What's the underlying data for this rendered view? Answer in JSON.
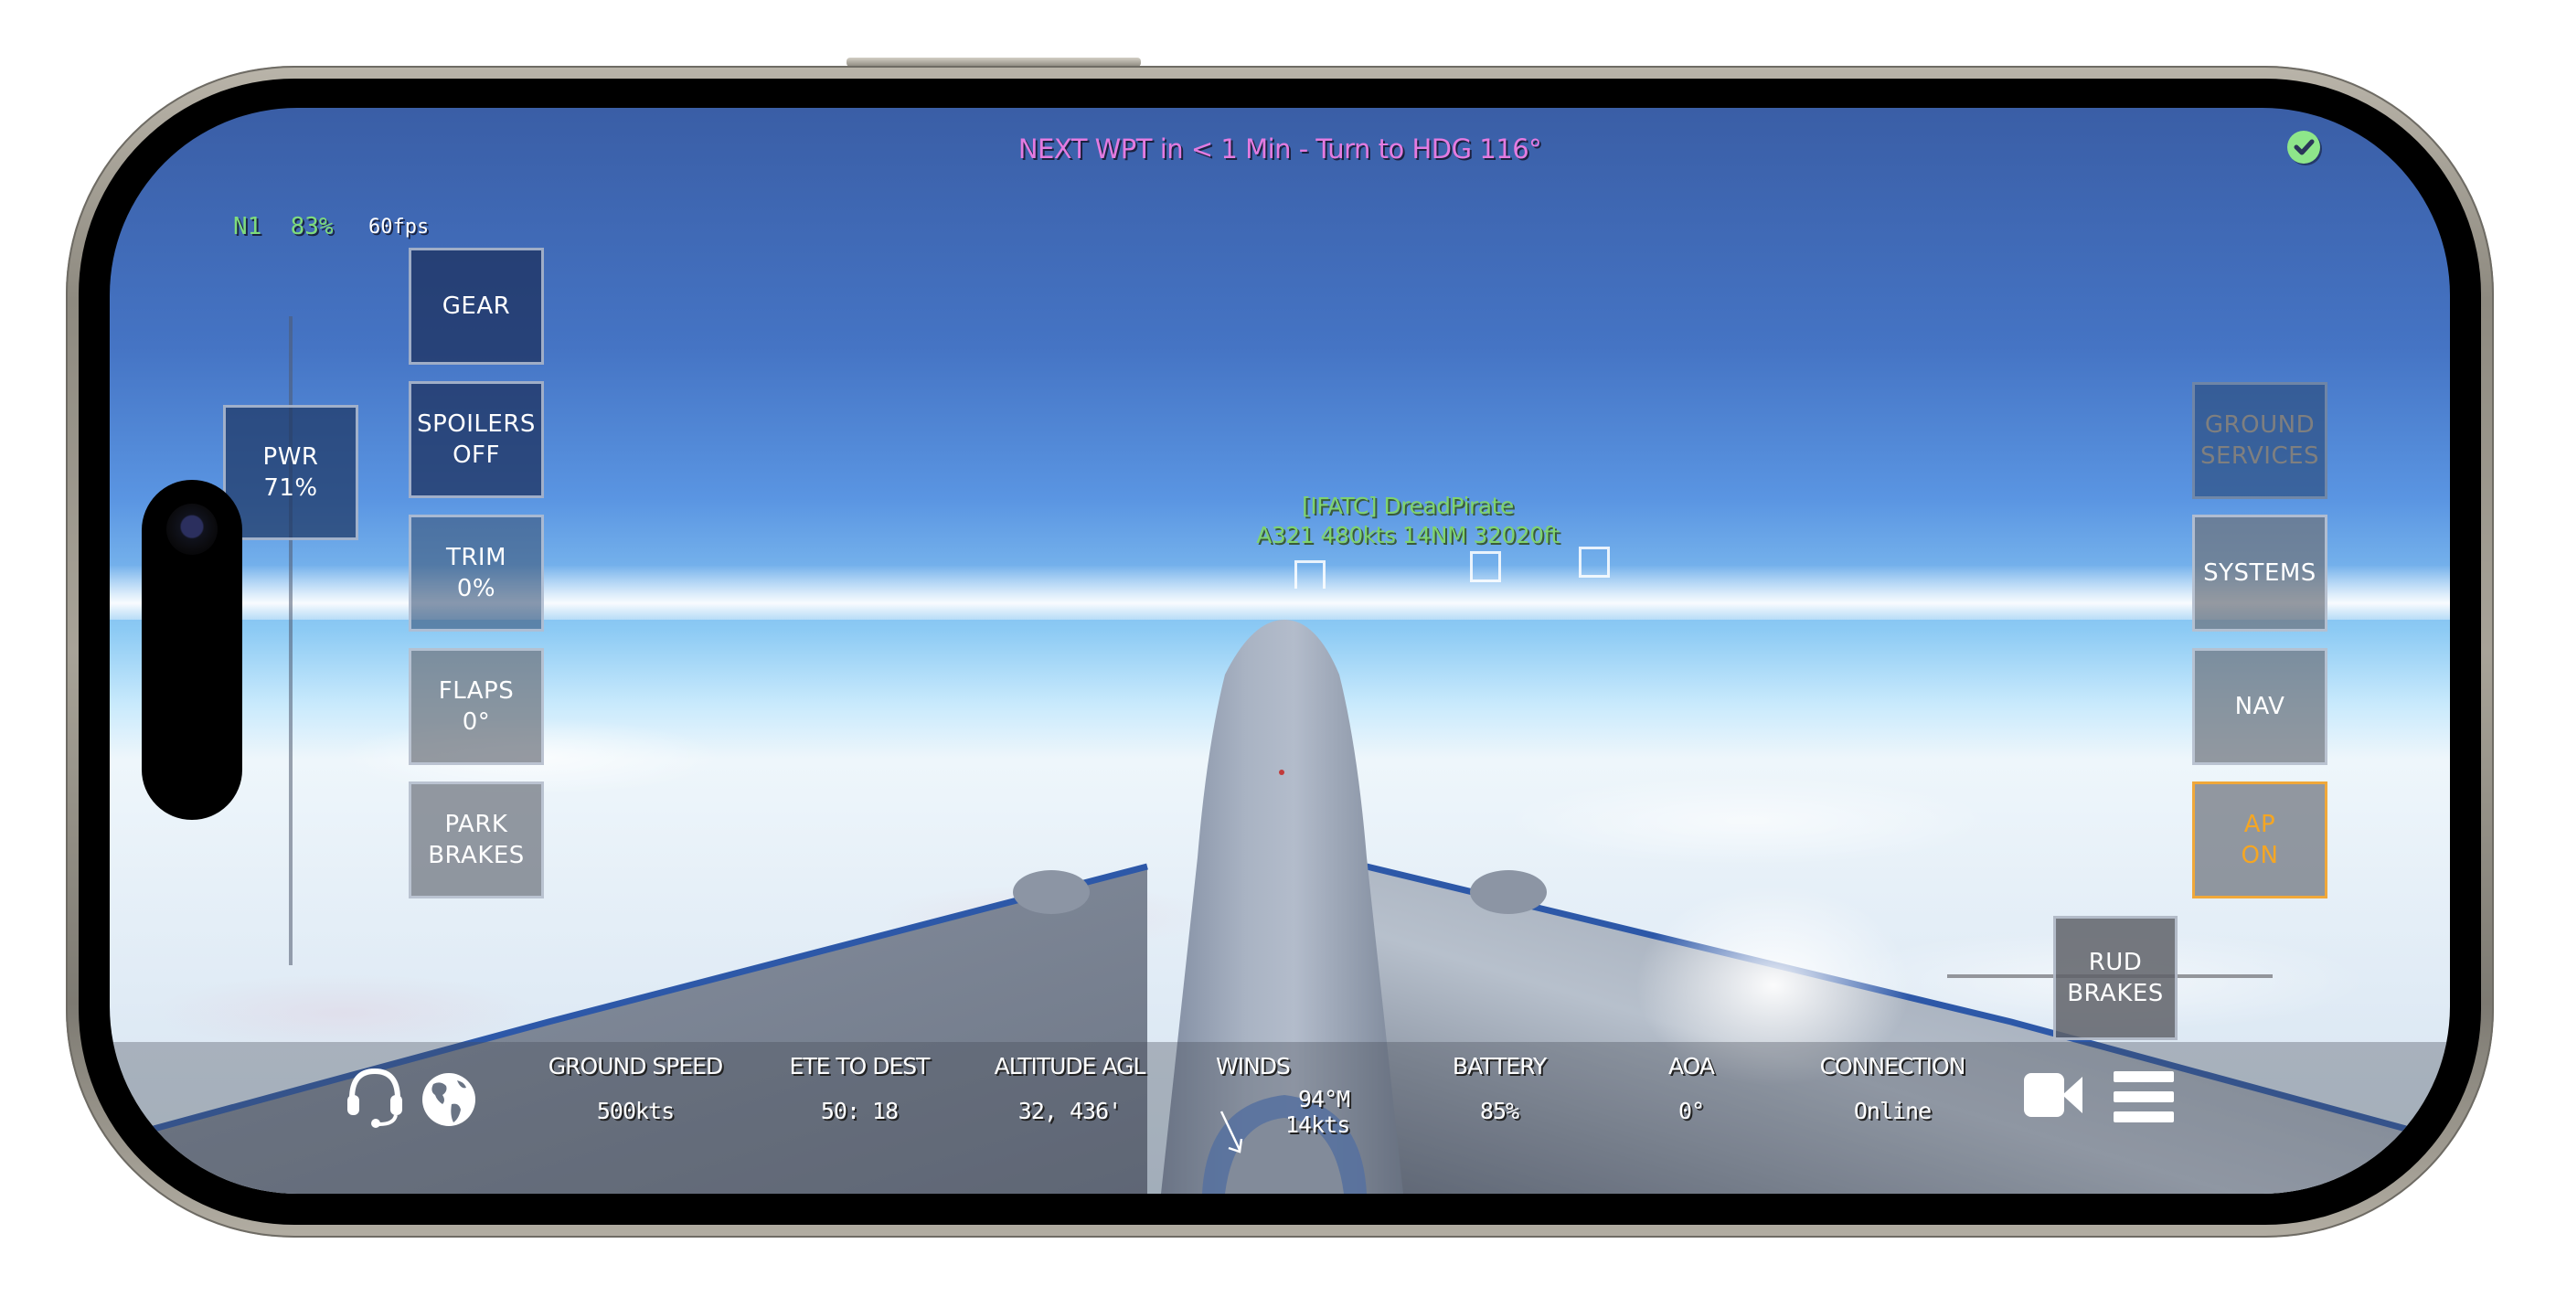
{
  "hud": {
    "waypoint_message": "NEXT WPT in < 1 Min - Turn to HDG 116°",
    "n1_label": "N1",
    "n1_value": "83%",
    "fps": "60fps",
    "status_icon": "check-circle-icon",
    "status_color": "#8ee68a"
  },
  "colors": {
    "waypoint_text": "#e47be0",
    "n1_text": "#7fdc7c",
    "callsign_text": "#7fd36f",
    "active_accent": "#f5a623"
  },
  "throttle": {
    "label": "PWR",
    "value": "71%",
    "fraction": 0.71
  },
  "left_buttons": [
    {
      "id": "gear",
      "line1": "GEAR",
      "line2": ""
    },
    {
      "id": "spoilers",
      "line1": "SPOILERS",
      "line2": "OFF"
    },
    {
      "id": "trim",
      "line1": "TRIM",
      "line2": "0%"
    },
    {
      "id": "flaps",
      "line1": "FLAPS",
      "line2": "0°"
    },
    {
      "id": "park-brakes",
      "line1": "PARK",
      "line2": "BRAKES"
    }
  ],
  "right_buttons": [
    {
      "id": "ground-services",
      "line1": "GROUND",
      "line2": "SERVICES",
      "state": "disabled"
    },
    {
      "id": "systems",
      "line1": "SYSTEMS",
      "line2": "",
      "state": "normal"
    },
    {
      "id": "nav",
      "line1": "NAV",
      "line2": "",
      "state": "normal"
    },
    {
      "id": "autopilot",
      "line1": "AP",
      "line2": "ON",
      "state": "active"
    }
  ],
  "rudder_button": {
    "line1": "RUD",
    "line2": "BRAKES"
  },
  "traffic": {
    "callsign": "[IFATC] DreadPirate",
    "details": "A321 480kts 14NM 32020ft"
  },
  "bottom_bar": {
    "left_icons": [
      "headset-icon",
      "globe-icon"
    ],
    "stats": [
      {
        "label": "GROUND SPEED",
        "value": "500kts"
      },
      {
        "label": "ETE TO DEST",
        "value": "50: 18"
      },
      {
        "label": "ALTITUDE AGL",
        "value": "32, 436'"
      },
      {
        "label": "WINDS",
        "value": "94°M",
        "value2": "14kts",
        "icon": "wind-arrow-icon"
      },
      {
        "label": "BATTERY",
        "value": "85%"
      },
      {
        "label": "AOA",
        "value": "0°"
      },
      {
        "label": "CONNECTION",
        "value": "Online"
      }
    ],
    "right_icons": [
      "camera-icon",
      "menu-icon"
    ]
  }
}
